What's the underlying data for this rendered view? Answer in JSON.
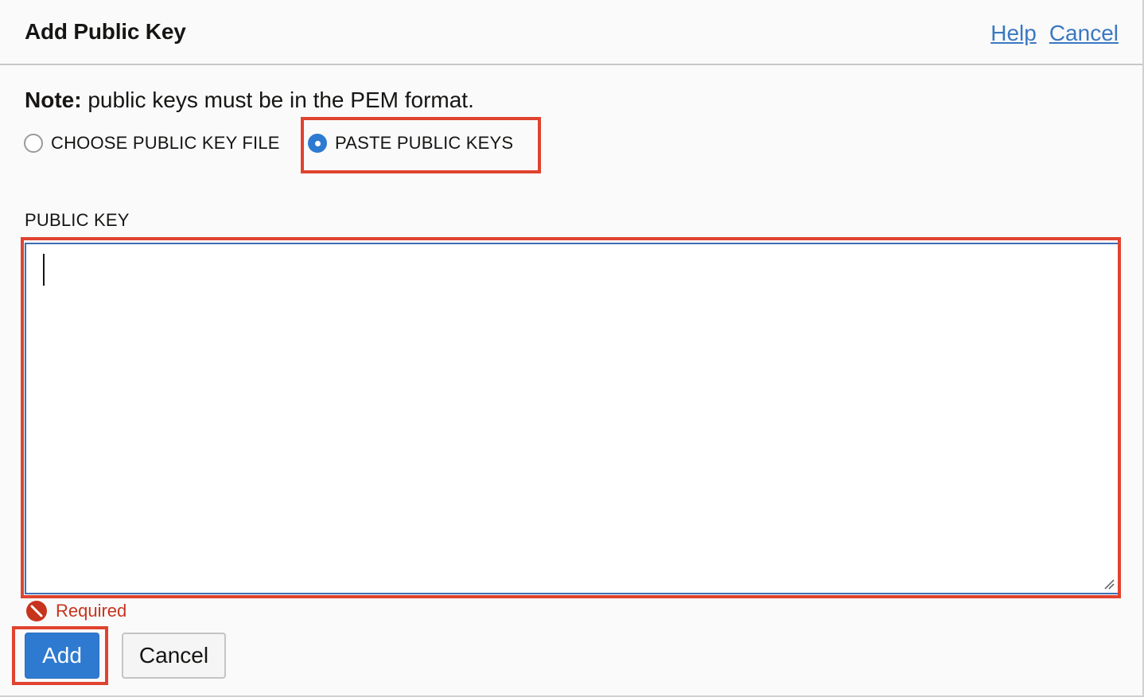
{
  "header": {
    "title": "Add Public Key",
    "help_link": "Help",
    "cancel_link": "Cancel"
  },
  "note": {
    "bold": "Note:",
    "text": " public keys must be in the PEM format."
  },
  "key_source": {
    "options": [
      {
        "label": "CHOOSE PUBLIC KEY FILE",
        "selected": false
      },
      {
        "label": "PASTE PUBLIC KEYS",
        "selected": true
      }
    ]
  },
  "public_key": {
    "label": "PUBLIC KEY",
    "value": "",
    "validation_message": "Required"
  },
  "actions": {
    "add_label": "Add",
    "cancel_label": "Cancel"
  },
  "colors": {
    "accent": "#2e7ad1",
    "link": "#3a78c2",
    "error": "#c8331c",
    "highlight": "#e0432f"
  }
}
